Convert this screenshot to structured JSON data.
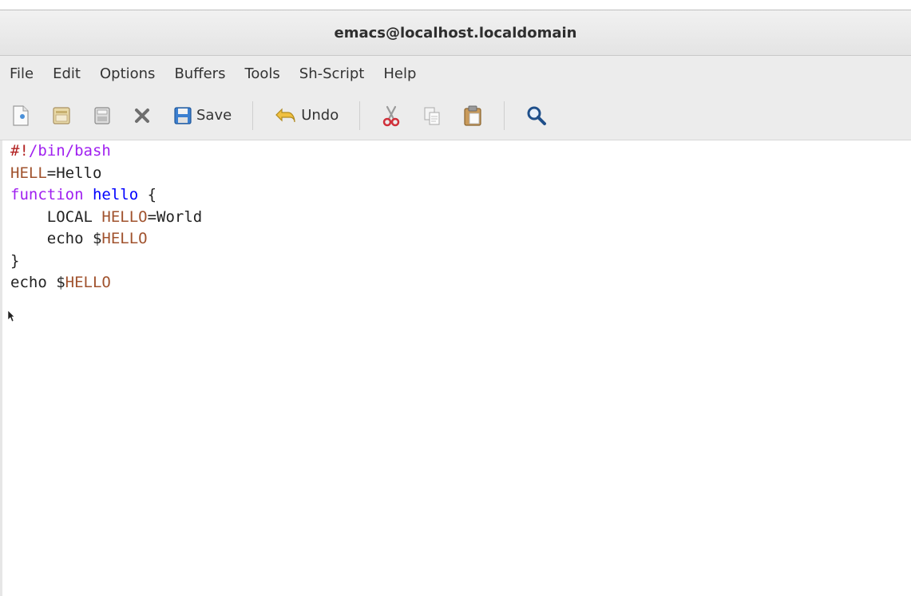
{
  "window": {
    "title": "emacs@localhost.localdomain"
  },
  "menubar": {
    "items": [
      "File",
      "Edit",
      "Options",
      "Buffers",
      "Tools",
      "Sh-Script",
      "Help"
    ]
  },
  "toolbar": {
    "save_label": "Save",
    "undo_label": "Undo",
    "icons": [
      "new-file-icon",
      "open-folder-icon",
      "save-buffer-icon",
      "close-icon",
      "save-icon",
      "undo-icon",
      "cut-icon",
      "copy-icon",
      "paste-icon",
      "search-icon"
    ]
  },
  "editor": {
    "lines": [
      [
        {
          "t": "#!",
          "c": "comment"
        },
        {
          "t": "/bin/bash",
          "c": "kw"
        }
      ],
      [
        {
          "t": "HELL",
          "c": "var"
        },
        {
          "t": "=Hello",
          "c": "plain"
        }
      ],
      [
        {
          "t": "function",
          "c": "kw"
        },
        {
          "t": " ",
          "c": "plain"
        },
        {
          "t": "hello",
          "c": "fn"
        },
        {
          "t": " {",
          "c": "plain"
        }
      ],
      [
        {
          "t": "    LOCAL ",
          "c": "plain"
        },
        {
          "t": "HELLO",
          "c": "var"
        },
        {
          "t": "=World",
          "c": "plain"
        }
      ],
      [
        {
          "t": "    ",
          "c": "plain"
        },
        {
          "t": "echo",
          "c": "plain"
        },
        {
          "t": " $",
          "c": "plain"
        },
        {
          "t": "HELLO",
          "c": "var"
        }
      ],
      [
        {
          "t": "}",
          "c": "plain"
        }
      ],
      [
        {
          "t": "echo",
          "c": "plain"
        },
        {
          "t": " $",
          "c": "plain"
        },
        {
          "t": "HELLO",
          "c": "var"
        }
      ]
    ]
  },
  "colors": {
    "comment": "#b22222",
    "keyword": "#a020f0",
    "function": "#0000ff",
    "variable": "#a0522d",
    "chrome": "#ececec"
  }
}
